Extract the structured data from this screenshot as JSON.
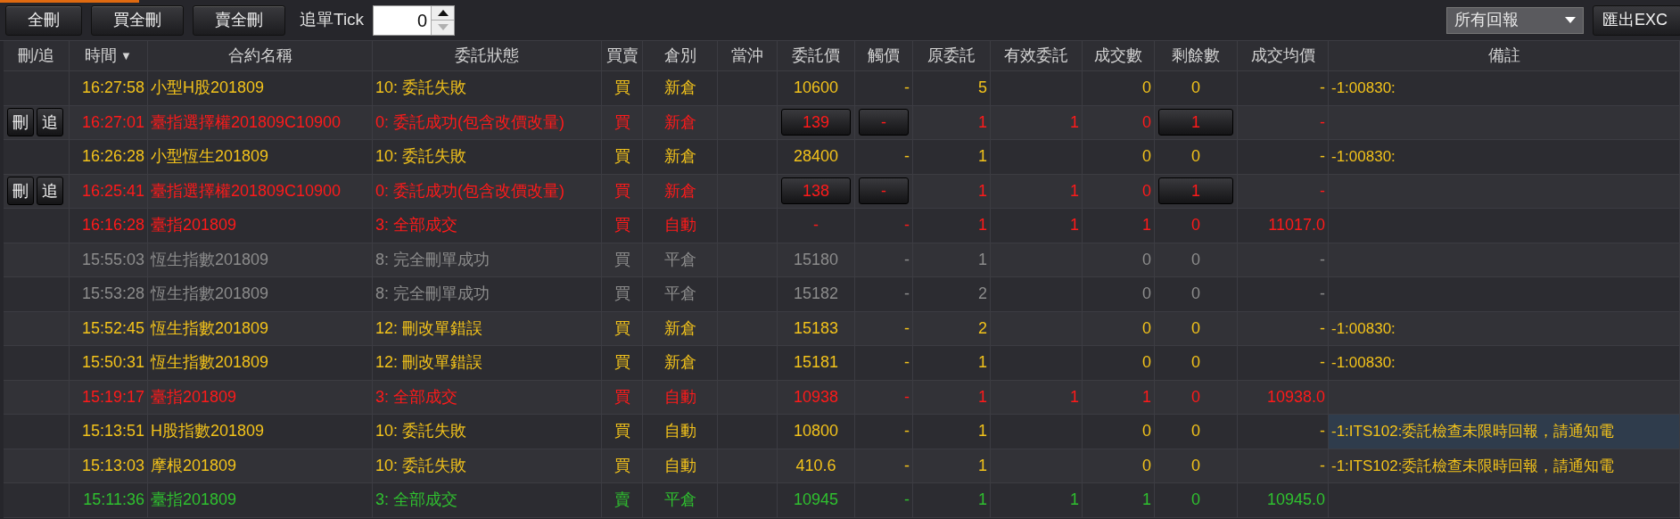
{
  "toolbar": {
    "buttons": [
      "全刪",
      "買全刪",
      "賣全刪"
    ],
    "tick_label": "追單Tick",
    "tick_value": "0",
    "tick_down_disabled": true,
    "filter": {
      "value": "所有回報"
    },
    "export_button": "匯出EXC"
  },
  "table": {
    "columns": [
      {
        "label": "刪/追"
      },
      {
        "label": "時間",
        "sort_indicator": "▼"
      },
      {
        "label": "合約名稱"
      },
      {
        "label": "委託狀態"
      },
      {
        "label": "買賣"
      },
      {
        "label": "倉別"
      },
      {
        "label": "當沖"
      },
      {
        "label": "委託價"
      },
      {
        "label": "觸價"
      },
      {
        "label": "原委託"
      },
      {
        "label": "有效委託"
      },
      {
        "label": "成交數"
      },
      {
        "label": "剩餘數"
      },
      {
        "label": "成交均價"
      },
      {
        "label": "備註"
      }
    ],
    "rows": [
      {
        "kind": "plain",
        "color": "#f2c21b",
        "selected": false,
        "time": "16:27:58",
        "contract": "小型H股201809",
        "status": "10: 委託失敗",
        "side": "買",
        "position": "新倉",
        "price": "10600",
        "trigger": "-",
        "original_qty": "5",
        "filled_qty": "0",
        "remaining_qty": "0",
        "avg_price": "-",
        "remark": "-1:00830:"
      },
      {
        "kind": "editable",
        "color": "#ff1a1a",
        "selected": false,
        "actions": [
          "刪",
          "追"
        ],
        "time": "16:27:01",
        "contract": "臺指選擇權201809C10900",
        "status": "0: 委託成功(包含改價改量)",
        "side": "買",
        "position": "新倉",
        "price": "139",
        "trigger": "-",
        "original_qty": "1",
        "valid_qty": "1",
        "filled_qty": "0",
        "remaining_qty": "1",
        "avg_price": "-"
      },
      {
        "kind": "plain",
        "color": "#f2c21b",
        "selected": false,
        "time": "16:26:28",
        "contract": "小型恆生201809",
        "status": "10: 委託失敗",
        "side": "買",
        "position": "新倉",
        "price": "28400",
        "trigger": "-",
        "original_qty": "1",
        "filled_qty": "0",
        "remaining_qty": "0",
        "avg_price": "-",
        "remark": "-1:00830:"
      },
      {
        "kind": "editable",
        "color": "#ff1a1a",
        "selected": false,
        "actions": [
          "刪",
          "追"
        ],
        "time": "16:25:41",
        "contract": "臺指選擇權201809C10900",
        "status": "0: 委託成功(包含改價改量)",
        "side": "買",
        "position": "新倉",
        "price": "138",
        "trigger": "-",
        "original_qty": "1",
        "valid_qty": "1",
        "filled_qty": "0",
        "remaining_qty": "1",
        "avg_price": "-"
      },
      {
        "kind": "plain",
        "color": "#ff1a1a",
        "selected": false,
        "time": "16:16:28",
        "contract": "臺指201809",
        "status": "3: 全部成交",
        "side": "買",
        "position": "自動",
        "price": "-",
        "trigger": "-",
        "original_qty": "1",
        "valid_qty": "1",
        "filled_qty": "1",
        "remaining_qty": "0",
        "avg_price": "11017.0"
      },
      {
        "kind": "plain",
        "color": "#8c8c8c",
        "selected": false,
        "time": "15:55:03",
        "contract": "恆生指數201809",
        "status": "8: 完全刪單成功",
        "side": "買",
        "position": "平倉",
        "price": "15180",
        "trigger": "-",
        "original_qty": "1",
        "filled_qty": "0",
        "remaining_qty": "0",
        "avg_price": "-"
      },
      {
        "kind": "plain",
        "color": "#8c8c8c",
        "selected": false,
        "time": "15:53:28",
        "contract": "恆生指數201809",
        "status": "8: 完全刪單成功",
        "side": "買",
        "position": "平倉",
        "price": "15182",
        "trigger": "-",
        "original_qty": "2",
        "filled_qty": "0",
        "remaining_qty": "0",
        "avg_price": "-"
      },
      {
        "kind": "plain",
        "color": "#f2c21b",
        "selected": false,
        "time": "15:52:45",
        "contract": "恆生指數201809",
        "status": "12: 刪改單錯誤",
        "side": "買",
        "position": "新倉",
        "price": "15183",
        "trigger": "-",
        "original_qty": "2",
        "filled_qty": "0",
        "remaining_qty": "0",
        "avg_price": "-",
        "remark": "-1:00830:"
      },
      {
        "kind": "plain",
        "color": "#f2c21b",
        "selected": false,
        "time": "15:50:31",
        "contract": "恆生指數201809",
        "status": "12: 刪改單錯誤",
        "side": "買",
        "position": "新倉",
        "price": "15181",
        "trigger": "-",
        "original_qty": "1",
        "filled_qty": "0",
        "remaining_qty": "0",
        "avg_price": "-",
        "remark": "-1:00830:"
      },
      {
        "kind": "plain",
        "color": "#ff1a1a",
        "selected": false,
        "time": "15:19:17",
        "contract": "臺指201809",
        "status": "3: 全部成交",
        "side": "買",
        "position": "自動",
        "price": "10938",
        "trigger": "-",
        "original_qty": "1",
        "valid_qty": "1",
        "filled_qty": "1",
        "remaining_qty": "0",
        "avg_price": "10938.0"
      },
      {
        "kind": "plain",
        "color": "#f2c21b",
        "selected": true,
        "time": "15:13:51",
        "contract": "H股指數201809",
        "status": "10: 委託失敗",
        "side": "買",
        "position": "自動",
        "price": "10800",
        "trigger": "-",
        "original_qty": "1",
        "filled_qty": "0",
        "remaining_qty": "0",
        "avg_price": "-",
        "remark": "-1:ITS102:委託檢查未限時回報，請通知電"
      },
      {
        "kind": "plain",
        "color": "#f2c21b",
        "selected": false,
        "time": "15:13:03",
        "contract": "摩根201809",
        "status": "10: 委託失敗",
        "side": "買",
        "position": "自動",
        "price": "410.6",
        "trigger": "-",
        "original_qty": "1",
        "filled_qty": "0",
        "remaining_qty": "0",
        "avg_price": "-",
        "remark": "-1:ITS102:委託檢查未限時回報，請通知電"
      },
      {
        "kind": "plain",
        "color": "#2fc02f",
        "selected": false,
        "time": "15:11:36",
        "contract": "臺指201809",
        "status": "3: 全部成交",
        "side": "賣",
        "position": "平倉",
        "price": "10945",
        "trigger": "-",
        "original_qty": "1",
        "valid_qty": "1",
        "filled_qty": "1",
        "remaining_qty": "0",
        "avg_price": "10945.0"
      }
    ]
  }
}
